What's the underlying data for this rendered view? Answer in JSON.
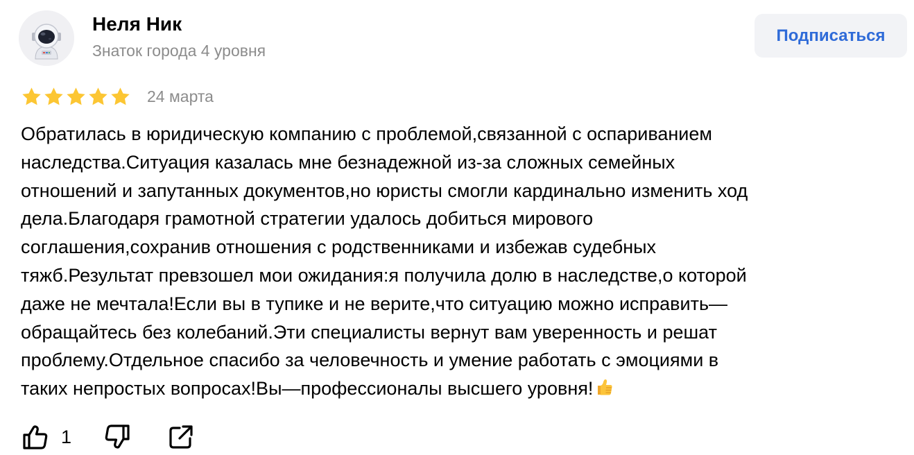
{
  "author": {
    "name": "Неля Ник",
    "level": "Знаток города 4 уровня",
    "avatar_icon": "astronaut-avatar"
  },
  "subscribe_label": "Подписаться",
  "rating": {
    "stars": 5,
    "max": 5,
    "color": "#fcc633"
  },
  "date": "24 марта",
  "text_lines": [
    "Обратилась в юридическую компанию с проблемой,связанной с оспариванием",
    "наследства.Ситуация казалась мне безнадежной из-за сложных семейных",
    "отношений и запутанных документов,но юристы смогли кардинально изменить ход",
    "дела.Благодаря грамотной стратегии удалось добиться мирового",
    "соглашения,сохранив отношения с родственниками и избежав судебных",
    "тяжб.Результат превзошел мои ожидания:я получила долю в наследстве,о которой",
    "даже не мечтала!Если вы в тупике и не верите,что ситуацию можно исправить—",
    "обращайтесь без колебаний.Эти специалисты вернут вам уверенность и решат",
    "проблему.Отдельное спасибо за человечность и умение работать с эмоциями в",
    "таких непростых вопросах!Вы—профессионалы высшего уровня!"
  ],
  "text_end_emoji": "thumbs-up-emoji",
  "actions": {
    "like_count": "1",
    "like_icon": "thumbs-up-icon",
    "dislike_icon": "thumbs-down-icon",
    "share_icon": "share-icon"
  },
  "colors": {
    "accent": "#2f6bd8",
    "secondary_text": "#8c8c8c",
    "button_bg": "#f2f3f6"
  }
}
